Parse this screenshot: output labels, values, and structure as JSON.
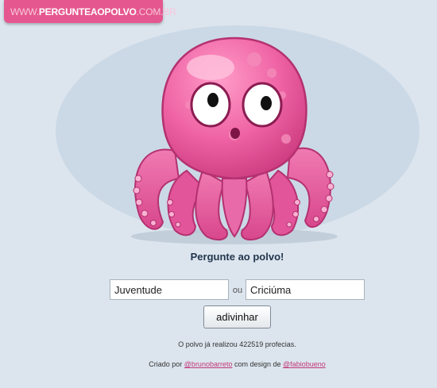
{
  "site_logo": {
    "prefix": "WWW.",
    "name": "PERGUNTEAOPOLVO",
    "suffix": ".COM.BR"
  },
  "mascot": {
    "icon": "octopus-mascot-icon",
    "colors": {
      "body": "#ee5fa0",
      "highlight": "#f9a0c8",
      "dark": "#c93b7e"
    }
  },
  "prompt": "Pergunte ao polvo!",
  "form": {
    "option_a": "Juventude",
    "separator": "ou",
    "option_b": "Criciúma",
    "submit_label": "adivinhar"
  },
  "stats_text": "O polvo já realizou 422519 profecias.",
  "credits": {
    "part1": "Criado por",
    "author1": "@brunobarreto",
    "part2": "com design de",
    "author2": "@fabiobueno"
  },
  "colors": {
    "page_bg": "#dce5ee",
    "ellipse_bg": "#cbd9e6",
    "logo_bg": "#e5578f",
    "link": "#c2387a"
  }
}
